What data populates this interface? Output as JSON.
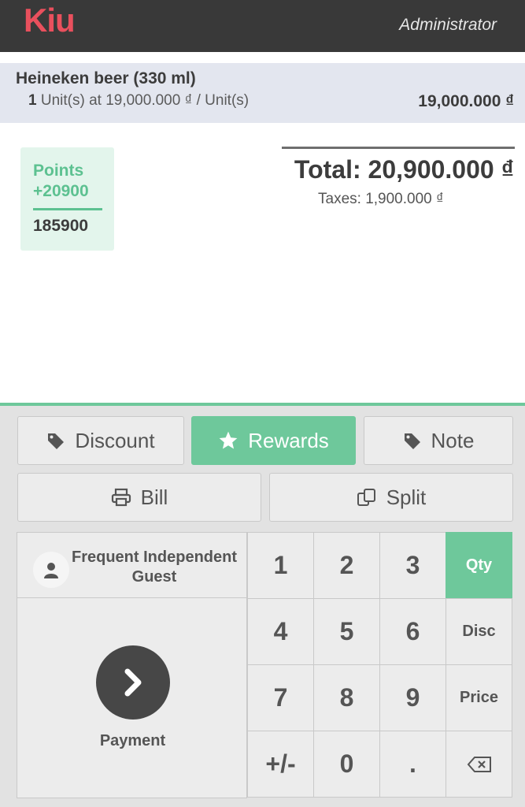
{
  "header": {
    "logo": "Kiu",
    "user": "Administrator"
  },
  "order": {
    "line": {
      "product": "Heineken beer (330 ml)",
      "qty": "1",
      "unit_info": " Unit(s) at 19,000.000 ₫ / Unit(s)",
      "price": "19,000.000 ₫"
    },
    "total": "Total: 20,900.000 ₫",
    "taxes": "Taxes: 1,900.000 ₫"
  },
  "points": {
    "label": "Points",
    "gained": "+20900",
    "total": "185900"
  },
  "actions": {
    "discount": "Discount",
    "rewards": "Rewards",
    "note": "Note",
    "bill": "Bill",
    "split": "Split"
  },
  "customer": {
    "name": "Frequent Independent Guest"
  },
  "payment": {
    "label": "Payment"
  },
  "numpad": {
    "keys": [
      "1",
      "2",
      "3",
      "4",
      "5",
      "6",
      "7",
      "8",
      "9",
      "+/-",
      "0",
      "."
    ],
    "modes": [
      "Qty",
      "Disc",
      "Price"
    ],
    "selected_mode": "Qty"
  },
  "colors": {
    "accent": "#6ec89b",
    "brand": "#e9505d",
    "header": "#393939"
  }
}
